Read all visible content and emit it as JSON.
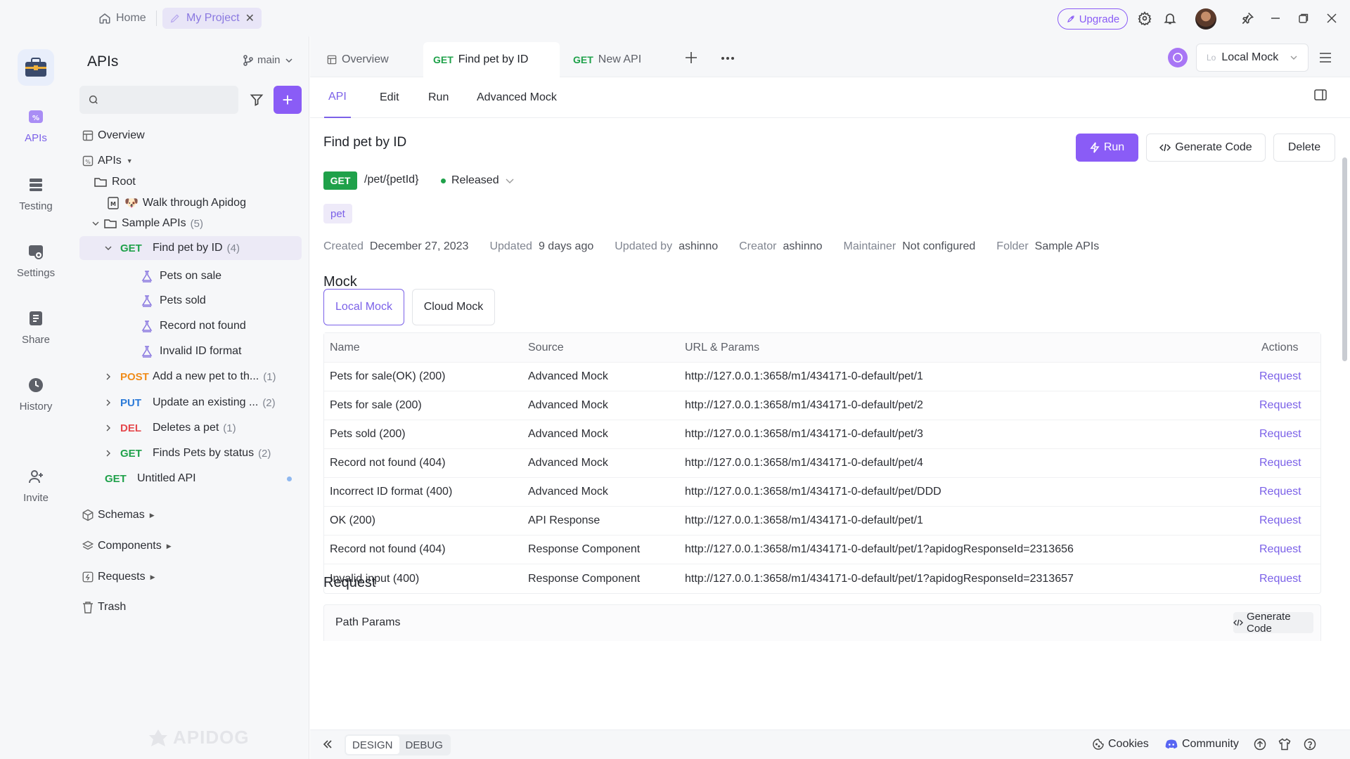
{
  "titlebar": {
    "home_label": "Home",
    "project_tab": "My Project",
    "upgrade_label": "Upgrade",
    "icons": [
      "settings-icon",
      "bell-icon",
      "pin-icon",
      "minimize-icon",
      "restore-icon",
      "close-icon"
    ]
  },
  "rail": {
    "items": [
      {
        "label": "APIs",
        "icon": "apis-icon",
        "active": true
      },
      {
        "label": "Testing",
        "icon": "testing-icon"
      },
      {
        "label": "Settings",
        "icon": "settings-icon"
      },
      {
        "label": "Share",
        "icon": "share-icon"
      },
      {
        "label": "History",
        "icon": "history-icon"
      },
      {
        "label": "Invite",
        "icon": "invite-icon"
      }
    ]
  },
  "sidebar": {
    "title": "APIs",
    "branch": "main",
    "search_placeholder": "",
    "tree": {
      "overview": "Overview",
      "apis": "APIs",
      "root": "Root",
      "walkthrough": "Walk through Apidog",
      "walkthrough_emoji": "🐶",
      "sample_apis": "Sample APIs",
      "sample_apis_count": "(5)",
      "find_pet_method": "GET",
      "find_pet": "Find pet by ID",
      "find_pet_count": "(4)",
      "mock_pets_on_sale": "Pets on sale",
      "mock_pets_sold": "Pets sold",
      "mock_record_not_found": "Record not found",
      "mock_invalid_id": "Invalid ID format",
      "add_pet_method": "POST",
      "add_pet": "Add a new pet to th...",
      "add_pet_count": "(1)",
      "update_pet_method": "PUT",
      "update_pet": "Update an existing ...",
      "update_pet_count": "(2)",
      "delete_pet_method": "DEL",
      "delete_pet": "Deletes a pet",
      "delete_pet_count": "(1)",
      "find_status_method": "GET",
      "find_status": "Finds Pets by status",
      "find_status_count": "(2)",
      "untitled_method": "GET",
      "untitled": "Untitled API",
      "schemas": "Schemas",
      "components": "Components",
      "requests": "Requests",
      "trash": "Trash"
    },
    "watermark": "APIDOG"
  },
  "tabs": {
    "overview": "Overview",
    "find_pet_method": "GET",
    "find_pet": "Find pet by ID",
    "new_api_method": "GET",
    "new_api": "New API",
    "env_prefix": "Lo",
    "env": "Local Mock"
  },
  "subtabs": [
    "API",
    "Edit",
    "Run",
    "Advanced Mock"
  ],
  "api": {
    "title": "Find pet by ID",
    "run_label": "Run",
    "generate_code_label": "Generate Code",
    "delete_label": "Delete",
    "method": "GET",
    "path": "/pet/{petId}",
    "status": "Released",
    "tag": "pet",
    "meta": [
      {
        "k": "Created",
        "v": "December 27, 2023"
      },
      {
        "k": "Updated",
        "v": "9 days ago"
      },
      {
        "k": "Updated by",
        "v": "ashinno"
      },
      {
        "k": "Creator",
        "v": "ashinno"
      },
      {
        "k": "Maintainer",
        "v": "Not configured"
      },
      {
        "k": "Folder",
        "v": "Sample APIs"
      }
    ]
  },
  "mock": {
    "heading": "Mock",
    "local_tab": "Local Mock",
    "cloud_tab": "Cloud Mock",
    "columns": [
      "Name",
      "Source",
      "URL & Params",
      "Actions"
    ],
    "rows": [
      {
        "name": "Pets for sale(OK) (200)",
        "source": "Advanced Mock",
        "url": "http://127.0.0.1:3658/m1/434171-0-default/pet/1",
        "action": "Request"
      },
      {
        "name": "Pets for sale (200)",
        "source": "Advanced Mock",
        "url": "http://127.0.0.1:3658/m1/434171-0-default/pet/2",
        "action": "Request"
      },
      {
        "name": "Pets sold (200)",
        "source": "Advanced Mock",
        "url": "http://127.0.0.1:3658/m1/434171-0-default/pet/3",
        "action": "Request"
      },
      {
        "name": "Record not found (404)",
        "source": "Advanced Mock",
        "url": "http://127.0.0.1:3658/m1/434171-0-default/pet/4",
        "action": "Request"
      },
      {
        "name": "Incorrect ID format (400)",
        "source": "Advanced Mock",
        "url": "http://127.0.0.1:3658/m1/434171-0-default/pet/DDD",
        "action": "Request"
      },
      {
        "name": "OK (200)",
        "source": "API Response",
        "url": "http://127.0.0.1:3658/m1/434171-0-default/pet/1",
        "action": "Request"
      },
      {
        "name": "Record not found (404)",
        "source": "Response Component",
        "url": "http://127.0.0.1:3658/m1/434171-0-default/pet/1?apidogResponseId=2313656",
        "action": "Request"
      },
      {
        "name": "Invalid input (400)",
        "source": "Response Component",
        "url": "http://127.0.0.1:3658/m1/434171-0-default/pet/1?apidogResponseId=2313657",
        "action": "Request"
      }
    ]
  },
  "request": {
    "heading": "Request",
    "path_params": "Path Params",
    "generate_code_label": "Generate Code"
  },
  "footer": {
    "design": "DESIGN",
    "debug": "DEBUG",
    "cookies": "Cookies",
    "community": "Community"
  },
  "colors": {
    "accent": "#8a5cf6",
    "get": "#1fa14a",
    "post": "#f08c1a",
    "put": "#2b7ad8",
    "delete": "#e5484d"
  }
}
